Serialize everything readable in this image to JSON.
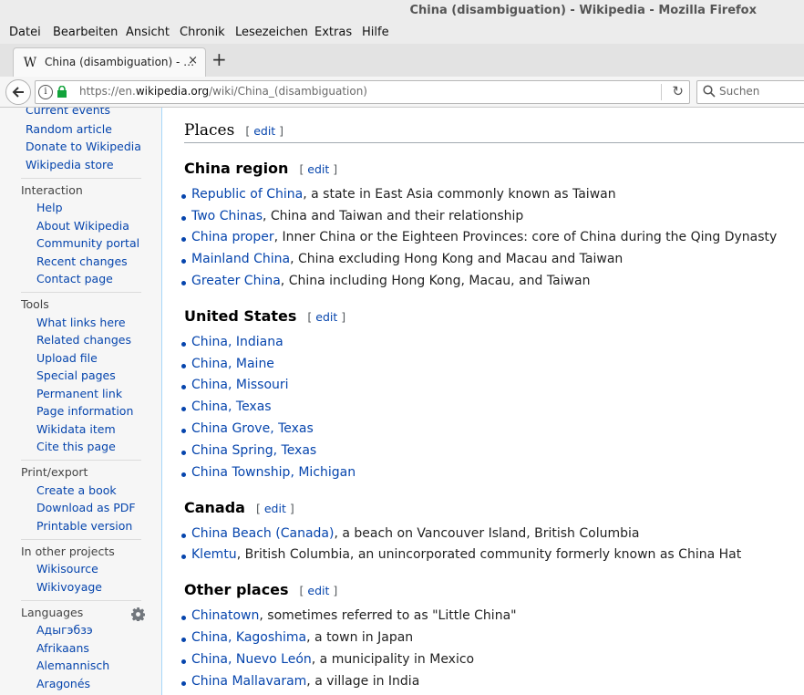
{
  "window": {
    "title": "China (disambiguation) - Wikipedia - Mozilla Firefox"
  },
  "menu": [
    "Datei",
    "Bearbeiten",
    "Ansicht",
    "Chronik",
    "Lesezeichen",
    "Extras",
    "Hilfe"
  ],
  "tab": {
    "title": "China (disambiguation) - …",
    "close": "×",
    "new_tab": "+"
  },
  "nav": {
    "url_prefix": "https://en.",
    "url_domain": "wikipedia.org",
    "url_path": "/wiki/China_(disambiguation)",
    "search_placeholder": "Suchen"
  },
  "sidebar": {
    "top_items": [
      "Current events",
      "Random article",
      "Donate to Wikipedia",
      "Wikipedia store"
    ],
    "interaction": {
      "heading": "Interaction",
      "items": [
        "Help",
        "About Wikipedia",
        "Community portal",
        "Recent changes",
        "Contact page"
      ]
    },
    "tools": {
      "heading": "Tools",
      "items": [
        "What links here",
        "Related changes",
        "Upload file",
        "Special pages",
        "Permanent link",
        "Page information",
        "Wikidata item",
        "Cite this page"
      ]
    },
    "print": {
      "heading": "Print/export",
      "items": [
        "Create a book",
        "Download as PDF",
        "Printable version"
      ]
    },
    "projects": {
      "heading": "In other projects",
      "items": [
        "Wikisource",
        "Wikivoyage"
      ]
    },
    "languages": {
      "heading": "Languages",
      "items": [
        "Адыгэбзэ",
        "Afrikaans",
        "Alemannisch",
        "Aragonés"
      ]
    }
  },
  "article": {
    "section_title": "Places",
    "edit_label": "edit",
    "sections": [
      {
        "title": "China region",
        "items": [
          {
            "link": "Republic of China",
            "rest": ", a state in East Asia commonly known as Taiwan"
          },
          {
            "link": "Two Chinas",
            "rest": ", China and Taiwan and their relationship"
          },
          {
            "link": "China proper",
            "rest": ", Inner China or the Eighteen Provinces: core of China during the Qing Dynasty"
          },
          {
            "link": "Mainland China",
            "rest": ", China excluding Hong Kong and Macau and Taiwan"
          },
          {
            "link": "Greater China",
            "rest": ", China including Hong Kong, Macau, and Taiwan"
          }
        ]
      },
      {
        "title": "United States",
        "items": [
          {
            "link": "China, Indiana",
            "rest": ""
          },
          {
            "link": "China, Maine",
            "rest": ""
          },
          {
            "link": "China, Missouri",
            "rest": ""
          },
          {
            "link": "China, Texas",
            "rest": ""
          },
          {
            "link": "China Grove, Texas",
            "rest": ""
          },
          {
            "link": "China Spring, Texas",
            "rest": ""
          },
          {
            "link": "China Township, Michigan",
            "rest": ""
          }
        ]
      },
      {
        "title": "Canada",
        "items": [
          {
            "link": "China Beach (Canada)",
            "rest": ", a beach on Vancouver Island, British Columbia"
          },
          {
            "link": "Klemtu",
            "rest": ", British Columbia, an unincorporated community formerly known as China Hat"
          }
        ]
      },
      {
        "title": "Other places",
        "items": [
          {
            "link": "Chinatown",
            "rest": ", sometimes referred to as \"Little China\""
          },
          {
            "link": "China, Kagoshima",
            "rest": ", a town in Japan"
          },
          {
            "link": "China, Nuevo León",
            "rest": ", a municipality in Mexico"
          },
          {
            "link": "China Mallavaram",
            "rest": ", a village in India"
          }
        ]
      }
    ]
  }
}
